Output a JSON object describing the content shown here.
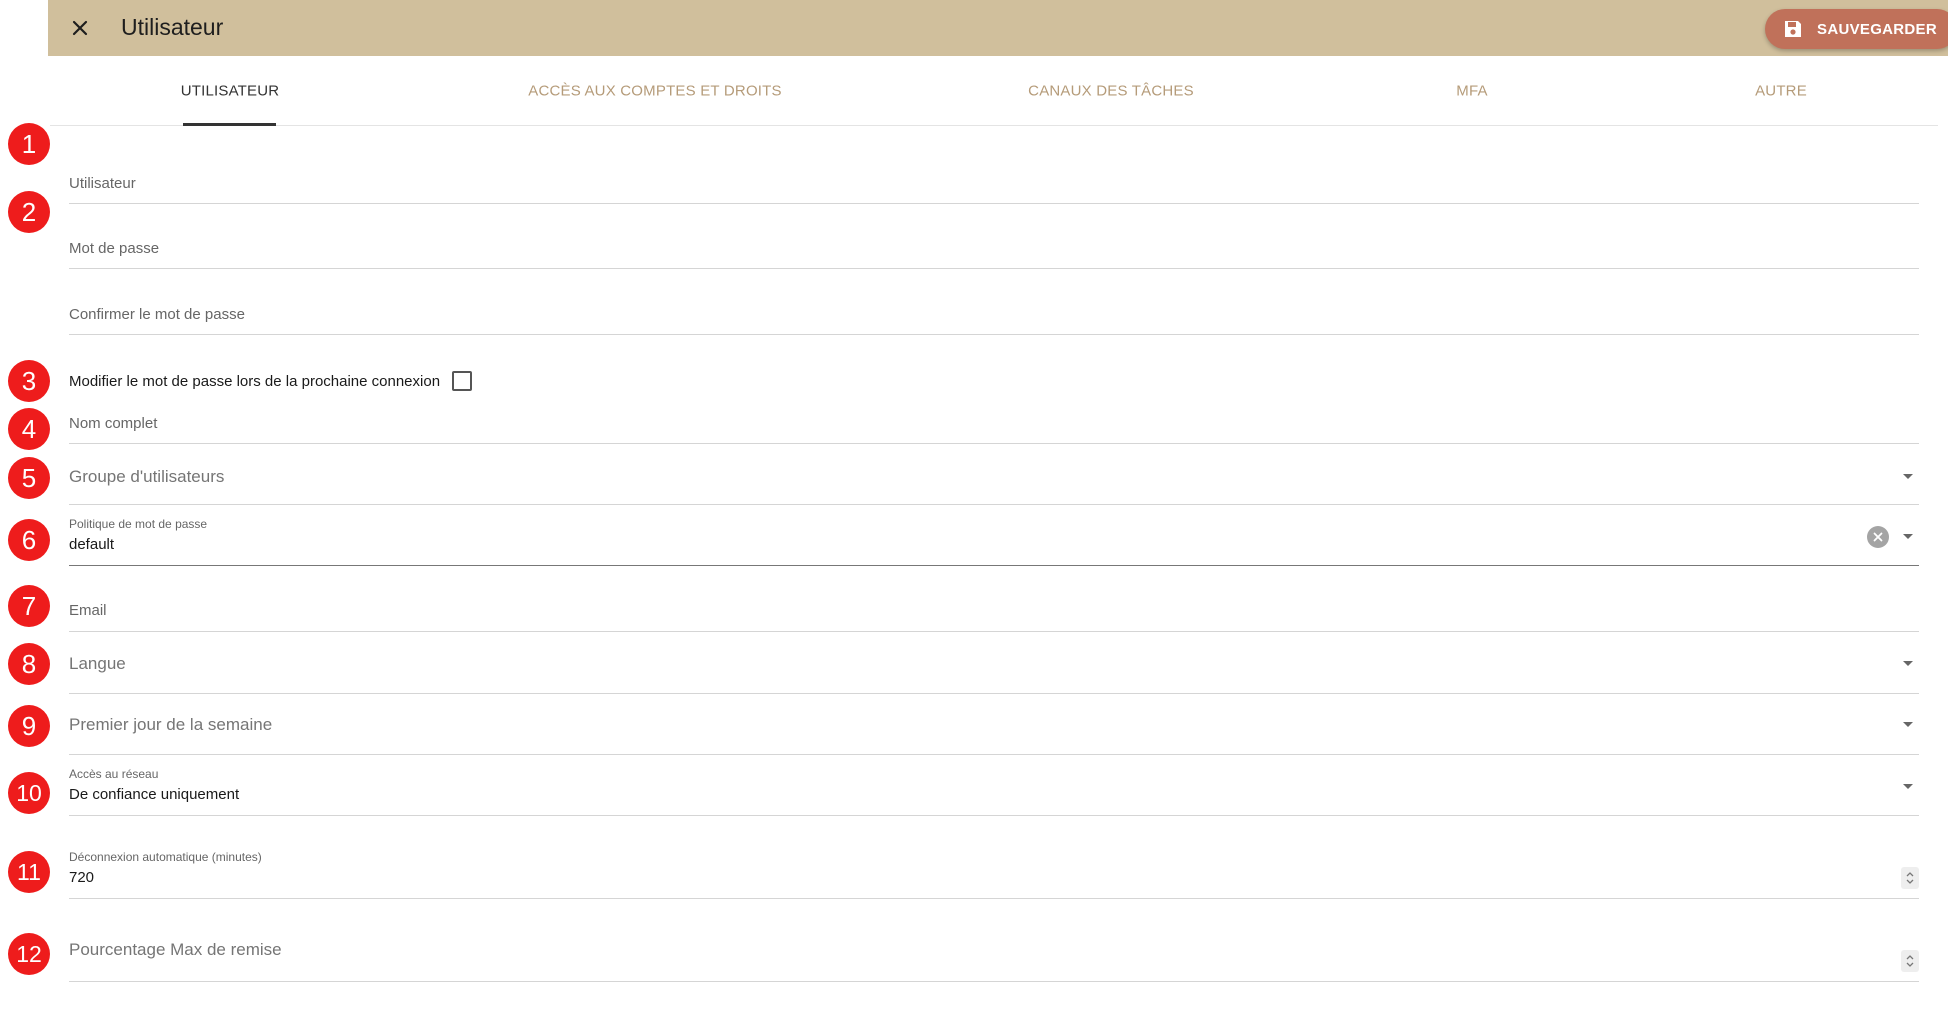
{
  "header": {
    "title": "Utilisateur",
    "save_label": "SAUVEGARDER",
    "background": "#d0bf9c",
    "save_color": "#c0715a"
  },
  "tabs": [
    {
      "label": "UTILISATEUR",
      "active": true
    },
    {
      "label": "ACCÈS AUX COMPTES ET DROITS",
      "active": false
    },
    {
      "label": "CANAUX DES TÂCHES",
      "active": false
    },
    {
      "label": "MFA",
      "active": false
    },
    {
      "label": "AUTRE",
      "active": false
    }
  ],
  "form": {
    "username": {
      "label": "Utilisateur",
      "value": ""
    },
    "password": {
      "label": "Mot de passe",
      "value": ""
    },
    "confirm_password": {
      "label": "Confirmer le mot de passe",
      "value": ""
    },
    "change_password_next_login": {
      "label": "Modifier le mot de passe lors de la prochaine connexion",
      "checked": false
    },
    "full_name": {
      "label": "Nom complet",
      "value": ""
    },
    "user_group": {
      "label": "Groupe d'utilisateurs",
      "value": ""
    },
    "password_policy": {
      "label": "Politique de mot de passe",
      "value": "default"
    },
    "email": {
      "label": "Email",
      "value": ""
    },
    "language": {
      "label": "Langue",
      "value": ""
    },
    "first_day_of_week": {
      "label": "Premier jour de la semaine",
      "value": ""
    },
    "network_access": {
      "label": "Accès au réseau",
      "value": "De confiance uniquement"
    },
    "auto_logout": {
      "label": "Déconnexion automatique (minutes)",
      "value": "720"
    },
    "max_discount": {
      "label": "Pourcentage Max de remise",
      "value": ""
    }
  },
  "badges": [
    "1",
    "2",
    "3",
    "4",
    "5",
    "6",
    "7",
    "8",
    "9",
    "10",
    "11",
    "12"
  ],
  "badge_color": "#ee1c1c",
  "icons": {
    "close": "close-icon",
    "save": "floppy-disk-icon",
    "dropdown": "chevron-down-icon",
    "clear": "clear-circle-icon",
    "spinner": "number-spinner-icon"
  }
}
